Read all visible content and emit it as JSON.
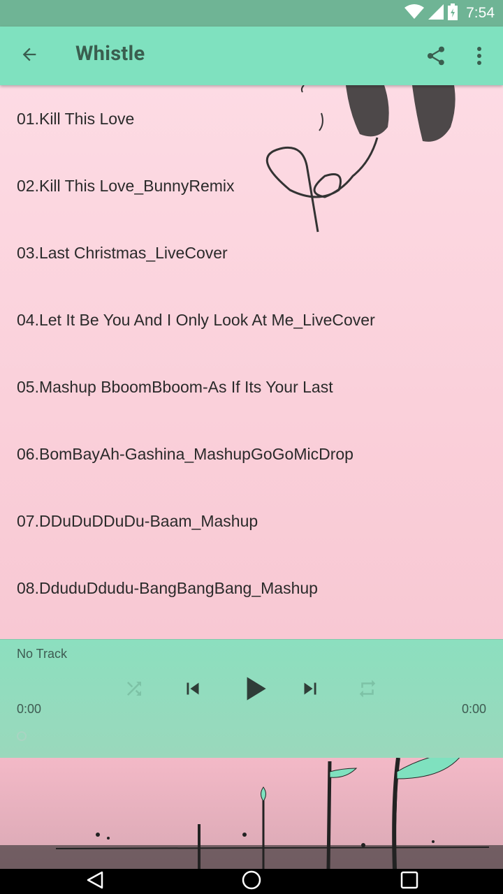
{
  "status_bar": {
    "time": "7:54"
  },
  "app_bar": {
    "title": "Whistle",
    "back_icon": "arrow-left-icon",
    "share_icon": "share-icon",
    "more_icon": "more-vertical-icon"
  },
  "tracks": [
    {
      "label": "01.Kill This Love"
    },
    {
      "label": "02.Kill This Love_BunnyRemix"
    },
    {
      "label": "03.Last Christmas_LiveCover"
    },
    {
      "label": "04.Let It Be You And I Only Look At Me_LiveCover"
    },
    {
      "label": "05.Mashup BboomBboom-As If Its Your Last"
    },
    {
      "label": "06.BomBayAh-Gashina_MashupGoGoMicDrop"
    },
    {
      "label": "07.DDuDuDDuDu-Baam_Mashup"
    },
    {
      "label": "08.DduduDdudu-BangBangBang_Mashup"
    }
  ],
  "player": {
    "now_playing": "No Track",
    "elapsed": "0:00",
    "duration": "0:00",
    "progress": 0
  },
  "colors": {
    "status_bar": "#6fb495",
    "app_bar": "#7fe1bf",
    "title_text": "#3a5e4f",
    "list_bg": "#fddbe4",
    "player_bg": "#8cdfbf",
    "player_icon": "#2f3d38",
    "player_icon_disabled": "#7dc2a6"
  }
}
